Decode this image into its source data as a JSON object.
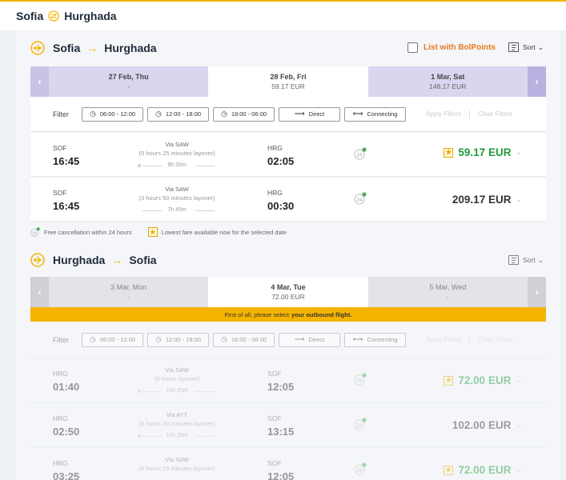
{
  "topbar": {
    "from": "Sofia",
    "to": "Hurghada"
  },
  "outbound": {
    "from": "Sofia",
    "arrow": "→",
    "to": "Hurghada",
    "bolpoints_label": "List with BolPoints",
    "sort_label": "Sort",
    "dates": [
      {
        "day": "27 Feb, Thu",
        "price": "-"
      },
      {
        "day": "28 Feb, Fri",
        "price": "59.17 EUR"
      },
      {
        "day": "1 Mar, Sat",
        "price": "148.17 EUR"
      }
    ],
    "filter": {
      "label": "Filter",
      "slot1": "06:00 - 12:00",
      "slot2": "12:00 - 18:00",
      "slot3": "18:00 - 06:00",
      "direct": "Direct",
      "connecting": "Connecting",
      "apply": "Apply Filters",
      "clear": "Clear Filters"
    },
    "flights": [
      {
        "dep_code": "SOF",
        "dep_time": "16:45",
        "via": "Via SAW",
        "layover": "(5 hours 25 minutes layover)",
        "duration": "9h 20m",
        "arr_code": "HRG",
        "arr_time": "02:05",
        "price": "59.17 EUR"
      },
      {
        "dep_code": "SOF",
        "dep_time": "16:45",
        "via": "Via SAW",
        "layover": "(3 hours 50 minutes layover)",
        "duration": "7h 45m",
        "arr_code": "HRG",
        "arr_time": "00:30",
        "price": "209.17 EUR"
      }
    ],
    "legend": {
      "cancellation": "Free cancellation within 24 hours",
      "lowest": "Lowest fare available now for the selected date"
    }
  },
  "inbound": {
    "from": "Hurghada",
    "arrow": "→",
    "to": "Sofia",
    "sort_label": "Sort",
    "dates": [
      {
        "day": "3 Mar, Mon",
        "price": "-"
      },
      {
        "day": "4 Mar, Tue",
        "price": "72.00 EUR"
      },
      {
        "day": "5 Mar, Wed",
        "price": "-"
      }
    ],
    "banner_prefix": "First of all, please select",
    "banner_bold": "your outbound flight.",
    "filter": {
      "label": "Filter",
      "slot1": "06:00 - 12:00",
      "slot2": "12:00 - 18:00",
      "slot3": "18:00 - 06:00",
      "direct": "Direct",
      "connecting": "Connecting",
      "apply": "Apply Filters",
      "clear": "Clear Filters"
    },
    "flights": [
      {
        "dep_code": "HRG",
        "dep_time": "01:40",
        "via": "Via SAW",
        "layover": "(6 hours layover)",
        "duration": "10h 25m",
        "arr_code": "SOF",
        "arr_time": "12:05",
        "price": "72.00 EUR"
      },
      {
        "dep_code": "HRG",
        "dep_time": "02:50",
        "via": "Via AYT",
        "layover": "(6 hours 30 minutes layover)",
        "duration": "10h 25m",
        "arr_code": "SOF",
        "arr_time": "13:15",
        "price": "102.00 EUR"
      },
      {
        "dep_code": "HRG",
        "dep_time": "03:25",
        "via": "Via SAW",
        "layover": "(4 hours 15 minutes layover)",
        "duration": "",
        "arr_code": "SOF",
        "arr_time": "12:05",
        "price": "72.00 EUR"
      }
    ]
  },
  "colors": {
    "accent": "#f5b400",
    "bolpoints": "#e87a20",
    "price_green": "#1f9b3a",
    "datebar": "#d9d6ef"
  }
}
